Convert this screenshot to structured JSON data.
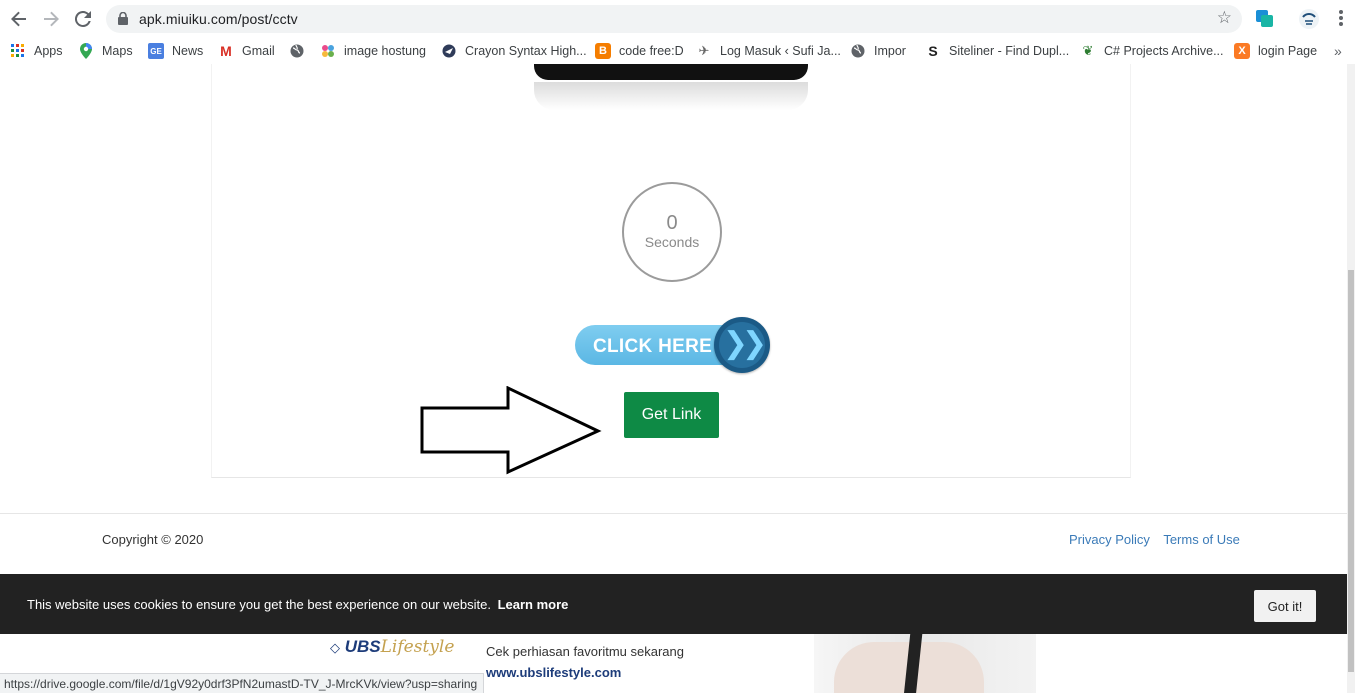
{
  "browser": {
    "url": "apk.miuiku.com/post/cctv",
    "bookmarks": [
      {
        "label": "Apps",
        "icon": "apps-grid-icon"
      },
      {
        "label": "Maps",
        "icon": "maps-pin-icon"
      },
      {
        "label": "News",
        "icon": "news-icon"
      },
      {
        "label": "Gmail",
        "icon": "gmail-icon"
      },
      {
        "label": "",
        "icon": "globe-icon"
      },
      {
        "label": "image hostung",
        "icon": "pinwheel-icon"
      },
      {
        "label": "Crayon Syntax High...",
        "icon": "crayon-icon"
      },
      {
        "label": "code free:D",
        "icon": "blogger-icon"
      },
      {
        "label": "Log Masuk ‹ Sufi Ja...",
        "icon": "bird-icon"
      },
      {
        "label": "Impor",
        "icon": "globe-icon"
      },
      {
        "label": "Siteliner - Find Dupl...",
        "icon": "siteliner-icon"
      },
      {
        "label": "C# Projects Archive...",
        "icon": "leaf-icon"
      },
      {
        "label": "login Page",
        "icon": "xampp-icon"
      }
    ],
    "status_url": "https://drive.google.com/file/d/1gV92y0drf3PfN2umastD-TV_J-MrcKVk/view?usp=sharing"
  },
  "page": {
    "timer": {
      "value": "0",
      "unit": "Seconds"
    },
    "click_here_label": "CLICK HERE",
    "click_here_chevrons": "❯❯",
    "get_link_label": "Get Link",
    "footer": {
      "copyright": "Copyright © 2020",
      "privacy": "Privacy Policy",
      "terms": "Terms of Use"
    },
    "cookie": {
      "message": "This website uses cookies to ensure you get the best experience on our website.",
      "learn_more": "Learn more",
      "button": "Got it!"
    },
    "ad": {
      "brand": "UBS",
      "brand_script": "Lifestyle",
      "tagline": "Cek perhiasan favoritmu sekarang",
      "website": "www.ubslifestyle.com"
    }
  },
  "colors": {
    "get_link": "#0e8a45",
    "cookie_bar": "#222222",
    "footer_link": "#3b7bb8",
    "click_here_pill": "#5bb7e4",
    "click_here_circle": "#1b5a86"
  }
}
